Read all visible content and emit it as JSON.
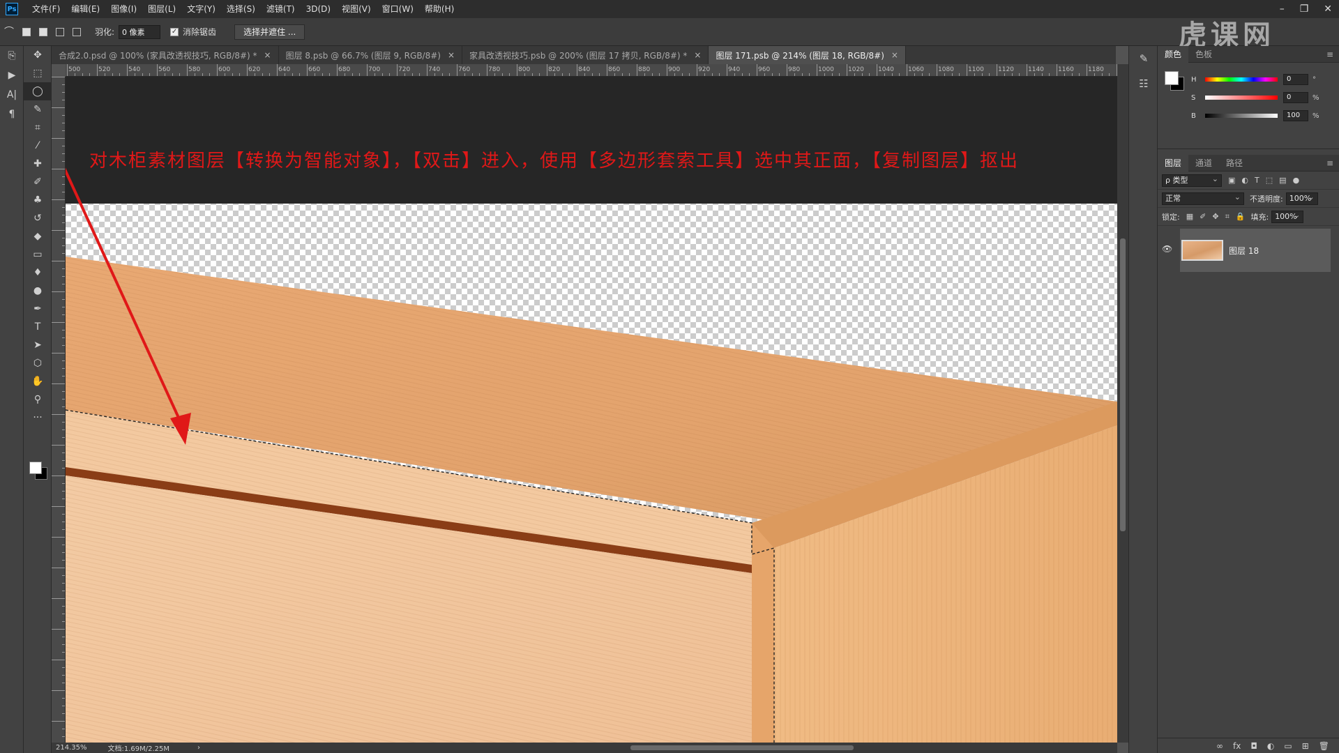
{
  "app": {
    "logo_text": "Ps",
    "menu": [
      "文件(F)",
      "编辑(E)",
      "图像(I)",
      "图层(L)",
      "文字(Y)",
      "选择(S)",
      "滤镜(T)",
      "3D(D)",
      "视图(V)",
      "窗口(W)",
      "帮助(H)"
    ],
    "window_controls": [
      "–",
      "❐",
      "✕"
    ],
    "watermark": "虎课网"
  },
  "options": {
    "feather_label": "羽化:",
    "feather_value": "0 像素",
    "antialias_label": "消除锯齿",
    "antialias_checked": true,
    "select_mask_label": "选择并遮住 ..."
  },
  "tabs": [
    {
      "label": "合成2.0.psd @ 100% (家具改透视技巧, RGB/8#) *",
      "active": false
    },
    {
      "label": "图层 8.psb @ 66.7% (图层 9, RGB/8#)",
      "active": false
    },
    {
      "label": "家具改透视技巧.psb @ 200% (图层 17 拷贝, RGB/8#) *",
      "active": false
    },
    {
      "label": "图层 171.psb @ 214% (图层 18, RGB/8#)",
      "active": true
    }
  ],
  "ruler": {
    "top_labels": [
      "500",
      "520",
      "540",
      "560",
      "580",
      "600",
      "620",
      "640",
      "660",
      "680",
      "700",
      "720",
      "740",
      "760",
      "780",
      "800",
      "820",
      "840",
      "860",
      "880",
      "900",
      "920",
      "940",
      "960",
      "980",
      "1000",
      "1020",
      "1040",
      "1060",
      "1080",
      "1100",
      "1120",
      "1140",
      "1160",
      "1180",
      "12"
    ]
  },
  "canvas": {
    "instruction_text": "对木柜素材图层【转换为智能对象】，【双击】进入，使用【多边形套索工具】选中其正面，【复制图层】抠出",
    "instruction_color": "#e01818",
    "arrow_color": "#e01818"
  },
  "status": {
    "zoom": "214.35%",
    "doc": "文档:1.69M/2.25M"
  },
  "color_panel": {
    "tabs": [
      "颜色",
      "色板"
    ],
    "sliders": [
      {
        "label": "H",
        "value": "0",
        "unit": "°"
      },
      {
        "label": "S",
        "value": "0",
        "unit": "%"
      },
      {
        "label": "B",
        "value": "100",
        "unit": "%"
      }
    ]
  },
  "layers_panel": {
    "tabs": [
      "图层",
      "通道",
      "路径"
    ],
    "filter_label": "ρ 类型",
    "blend_mode": "正常",
    "opacity_label": "不透明度:",
    "opacity_value": "100%",
    "lock_label": "锁定:",
    "fill_label": "填充:",
    "fill_value": "100%",
    "layer_name": "图层 18"
  },
  "icons": {
    "left_strip": [
      "history-icon",
      "play-icon",
      "character-icon",
      "paragraph-icon"
    ],
    "tools": [
      "move-icon",
      "marquee-icon",
      "lasso-icon",
      "quick-select-icon",
      "crop-icon",
      "eyedropper-icon",
      "healing-icon",
      "brush-icon",
      "stamp-icon",
      "history-brush-icon",
      "eraser-icon",
      "gradient-icon",
      "blur-icon",
      "dodge-icon",
      "pen-icon",
      "type-icon",
      "path-select-icon",
      "shape-icon",
      "hand-icon",
      "zoom-icon",
      "more-icon"
    ],
    "right_strip": [
      "brush-settings-icon",
      "properties-icon"
    ]
  }
}
